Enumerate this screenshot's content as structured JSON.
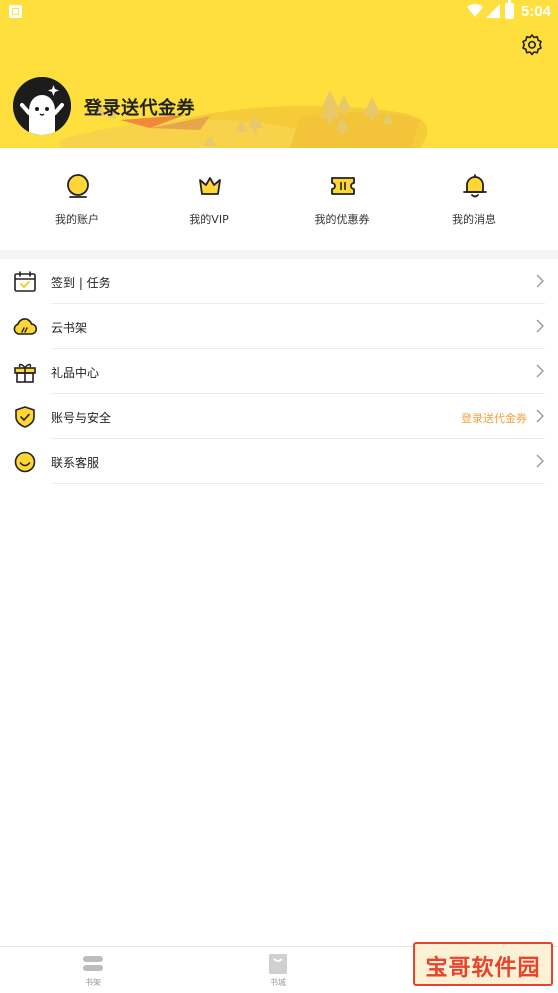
{
  "status_bar": {
    "time": "5:04"
  },
  "header": {
    "login_title": "登录送代金券"
  },
  "quick_actions": [
    {
      "label": "我的账户",
      "icon": "coin-icon"
    },
    {
      "label": "我的VIP",
      "icon": "crown-icon"
    },
    {
      "label": "我的优惠券",
      "icon": "coupon-icon"
    },
    {
      "label": "我的消息",
      "icon": "bell-icon"
    }
  ],
  "menu": [
    {
      "label": "签到 | 任务",
      "icon": "calendar-check-icon",
      "hint": ""
    },
    {
      "label": "云书架",
      "icon": "cloud-book-icon",
      "hint": ""
    },
    {
      "label": "礼品中心",
      "icon": "gift-icon",
      "hint": ""
    },
    {
      "label": "账号与安全",
      "icon": "shield-check-icon",
      "hint": "登录送代金券"
    },
    {
      "label": "联系客服",
      "icon": "smiley-icon",
      "hint": ""
    }
  ],
  "tabbar": {
    "tabs": [
      {
        "label": "书架",
        "icon": "bookshelf-icon"
      },
      {
        "label": "书城",
        "icon": "bookstore-icon"
      }
    ]
  },
  "watermark": {
    "text": "宝哥软件园"
  },
  "colors": {
    "accent": "#FFDF3D",
    "hint": "#F5A03C",
    "icon_yellow": "#FFD633",
    "watermark_red": "#E8432C"
  }
}
